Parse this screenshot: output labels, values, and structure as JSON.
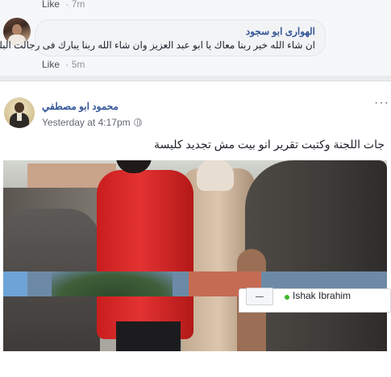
{
  "comment_top": {
    "like_label": "Like",
    "time": "7m"
  },
  "comment": {
    "author": "الهوارى ابو سجود",
    "text": "ان شاء الله خير ربنا معاك يا ابو عبد العزيز وان شاء الله ربنا يبارك فى رجالت البلد",
    "like_label": "Like",
    "time": "5m"
  },
  "post": {
    "author": "محمود ابو مصطفي",
    "timestamp": "Yesterday at 4:17pm",
    "text": "جات اللجنة وكتبت تقرير انو بيت مش تجديد كليسة",
    "more_icon": "more-options-icon",
    "privacy_icon": "globe-icon"
  },
  "chat": {
    "contact_name": "Ishak Ibrahim",
    "status_color": "#42b72a"
  },
  "colors": {
    "link": "#365899",
    "meta": "#90949c",
    "background": "#e9ebee"
  }
}
